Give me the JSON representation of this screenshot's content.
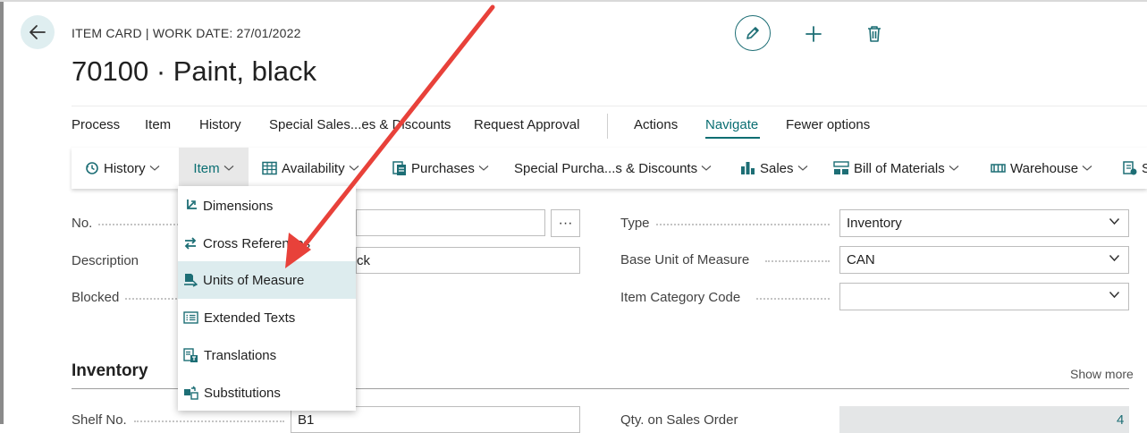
{
  "header": {
    "caption": "ITEM CARD | WORK DATE: 27/01/2022",
    "title": "70100 · Paint, black"
  },
  "action_tabs": [
    {
      "label": "Process"
    },
    {
      "label": "Item"
    },
    {
      "label": "History"
    },
    {
      "label": "Special Sales...es & Discounts"
    },
    {
      "label": "Request Approval"
    },
    {
      "label": "Actions"
    },
    {
      "label": "Navigate",
      "active": true
    },
    {
      "label": "Fewer options"
    }
  ],
  "navigate_bar": [
    {
      "label": "History",
      "icon": "history-icon"
    },
    {
      "label": "Item",
      "open": true
    },
    {
      "label": "Availability",
      "icon": "table-icon"
    },
    {
      "label": "Purchases",
      "icon": "purchase-doc-icon"
    },
    {
      "label": "Special Purcha...s & Discounts"
    },
    {
      "label": "Sales",
      "icon": "sales-icon"
    },
    {
      "label": "Bill of Materials",
      "icon": "bom-icon"
    },
    {
      "label": "Warehouse",
      "icon": "warehouse-icon"
    },
    {
      "label": "S",
      "icon": "service-icon"
    }
  ],
  "item_menu": [
    {
      "label": "Dimensions",
      "icon": "dimensions-icon"
    },
    {
      "label": "Cross References",
      "icon": "cross-references-icon"
    },
    {
      "label": "Units of Measure",
      "icon": "units-of-measure-icon",
      "highlighted": true
    },
    {
      "label": "Extended Texts",
      "icon": "extended-texts-icon"
    },
    {
      "label": "Translations",
      "icon": "translations-icon"
    },
    {
      "label": "Substitutions",
      "icon": "substitutions-icon"
    }
  ],
  "fields": {
    "no_label": "No.",
    "description_label": "Description",
    "description_tail": "ck",
    "blocked_label": "Blocked",
    "type_label": "Type",
    "type_value": "Inventory",
    "base_uom_label": "Base Unit of Measure",
    "base_uom_value": "CAN",
    "item_category_label": "Item Category Code",
    "item_category_value": "",
    "assist_label": "···"
  },
  "inventory": {
    "title": "Inventory",
    "show_more": "Show more",
    "shelf_no_label": "Shelf No.",
    "shelf_no_value": "B1",
    "qty_sales_order_label": "Qty. on Sales Order",
    "qty_sales_order_value": "4"
  },
  "colors": {
    "accent": "#0a6e72",
    "annotation_arrow": "#e8413a",
    "highlight": "#ddecee"
  }
}
